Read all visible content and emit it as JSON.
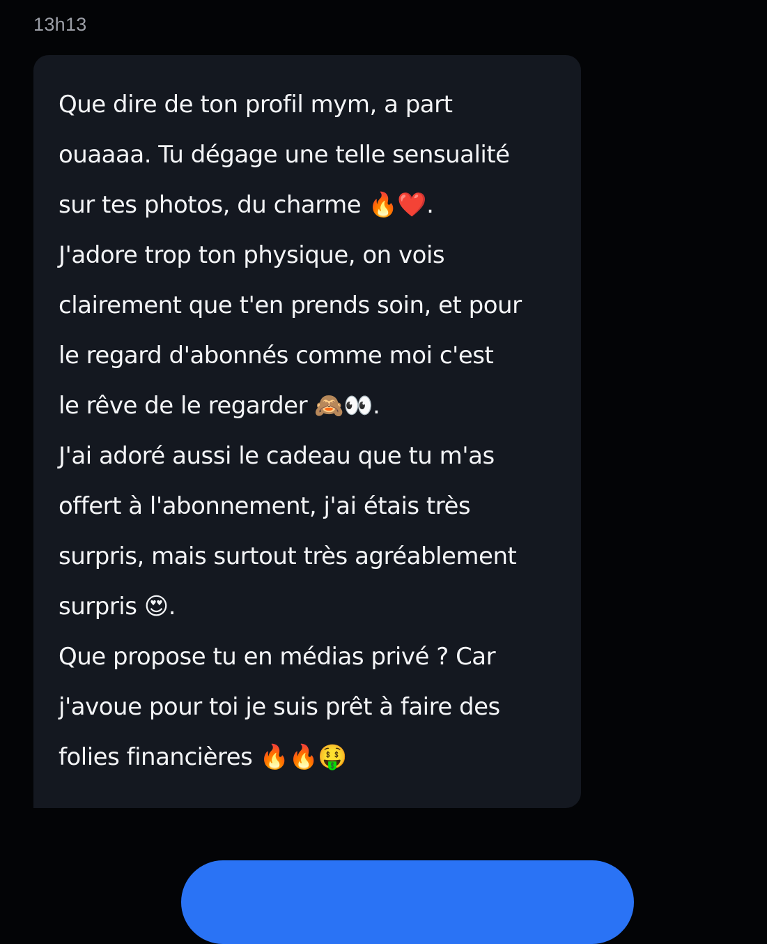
{
  "message": {
    "timestamp": "13h13",
    "lines": [
      "Que dire de ton profil mym, a part",
      "ouaaaa. Tu dégage une telle sensualité",
      "sur tes photos, du charme 🔥❤️.",
      "J'adore trop ton physique, on vois",
      "clairement que t'en prends soin, et pour",
      "le regard d'abonnés comme moi c'est",
      "le rêve de le regarder 🙈👀.",
      "J'ai adoré aussi le cadeau que tu m'as",
      "offert à l'abonnement, j'ai étais très",
      "surpris, mais surtout très agréablement",
      "surpris 😍.",
      "Que propose tu en médias privé ? Car",
      "j'avoue pour toi je suis prêt à faire des",
      "folies financières 🔥🔥🤑"
    ]
  },
  "colors": {
    "background": "#030406",
    "bubble": "#141820",
    "text": "#f3f4f6",
    "timestamp": "#9b9ea6",
    "button": "#2a73f5"
  }
}
